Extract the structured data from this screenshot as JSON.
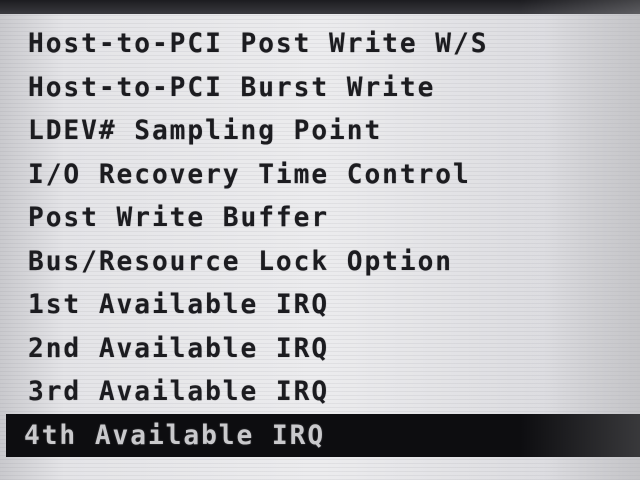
{
  "menu": {
    "items": [
      {
        "label": "Host-to-PCI Post Write W/S"
      },
      {
        "label": "Host-to-PCI Burst Write"
      },
      {
        "label": "LDEV# Sampling Point"
      },
      {
        "label": "I/O Recovery Time Control"
      },
      {
        "label": "Post Write Buffer"
      },
      {
        "label": "Bus/Resource Lock Option"
      },
      {
        "label": "1st Available IRQ"
      },
      {
        "label": "2nd Available IRQ"
      },
      {
        "label": "3rd Available IRQ"
      },
      {
        "label": "4th Available IRQ",
        "selected": true
      }
    ]
  },
  "colors": {
    "background": "#e6e6e9",
    "text": "#1c1c20",
    "highlight_background": "#0d0d10",
    "highlight_text": "#c9c9cc"
  }
}
